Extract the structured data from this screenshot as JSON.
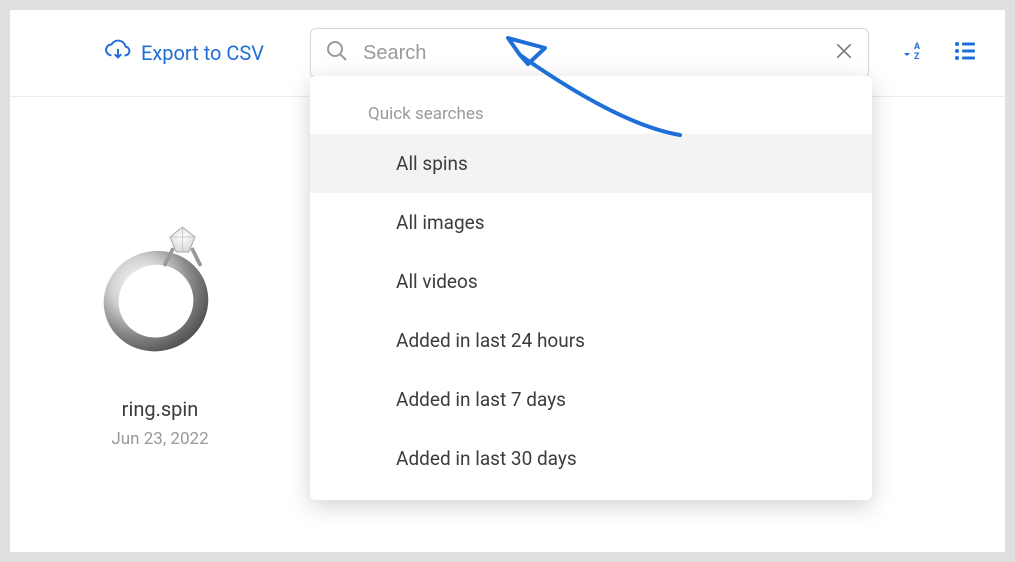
{
  "toolbar": {
    "export_label": "Export to CSV"
  },
  "search": {
    "placeholder": "Search",
    "value": "",
    "dropdown_header": "Quick searches",
    "quick_searches": [
      {
        "label": "All spins"
      },
      {
        "label": "All images"
      },
      {
        "label": "All videos"
      },
      {
        "label": "Added in last 24 hours"
      },
      {
        "label": "Added in last 7 days"
      },
      {
        "label": "Added in last 30 days"
      }
    ]
  },
  "items": [
    {
      "name": "ring.spin",
      "date": "Jun 23, 2022"
    }
  ],
  "colors": {
    "accent": "#1e6fd8",
    "muted_text": "#9a9a9a"
  }
}
